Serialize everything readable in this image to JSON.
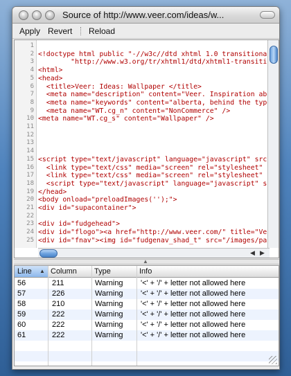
{
  "window": {
    "title": "Source of http://www.veer.com/ideas/w..."
  },
  "toolbar": {
    "apply": "Apply",
    "revert": "Revert",
    "reload": "Reload"
  },
  "editor": {
    "lines": [
      {
        "no": "1",
        "text": ""
      },
      {
        "no": "2",
        "text": "<!doctype html public \"-//w3c//dtd xhtml 1.0 transitiona"
      },
      {
        "no": "3",
        "text": "        \"http://www.w3.org/tr/xhtml1/dtd/xhtml1-transiti"
      },
      {
        "no": "4",
        "text": "<html>"
      },
      {
        "no": "5",
        "text": "<head>"
      },
      {
        "no": "6",
        "text": "  <title>Veer: Ideas: Wallpaper </title>"
      },
      {
        "no": "7",
        "text": "  <meta name=\"description\" content=\"Veer. Inspiration abo"
      },
      {
        "no": "8",
        "text": "  <meta name=\"keywords\" content=\"alberta, behind the type"
      },
      {
        "no": "9",
        "text": "  <meta name=\"WT.cg_n\" content=\"NonCommerce\" />"
      },
      {
        "no": "10",
        "text": "<meta name=\"WT.cg_s\" content=\"Wallpaper\" />"
      },
      {
        "no": "11",
        "text": ""
      },
      {
        "no": "12",
        "text": ""
      },
      {
        "no": "13",
        "text": ""
      },
      {
        "no": "14",
        "text": ""
      },
      {
        "no": "15",
        "text": "<script type=\"text/javascript\" language=\"javascript\" src"
      },
      {
        "no": "16",
        "text": "  <link type=\"text/css\" media=\"screen\" rel=\"stylesheet\" h"
      },
      {
        "no": "17",
        "text": "  <link type=\"text/css\" media=\"screen\" rel=\"stylesheet\" h"
      },
      {
        "no": "18",
        "text": "  <script type=\"text/javascript\" language=\"javascript\" sr"
      },
      {
        "no": "19",
        "text": "</head>"
      },
      {
        "no": "20",
        "text": "<body onload=\"preloadImages('');\">"
      },
      {
        "no": "21",
        "text": "<div id=\"supacontainer\">"
      },
      {
        "no": "22",
        "text": ""
      },
      {
        "no": "23",
        "text": "<div id=\"fudgehead\">"
      },
      {
        "no": "24",
        "text": "<div id=\"flogo\"><a href=\"http://www.veer.com/\" title=\"Ve"
      },
      {
        "no": "25",
        "text": "<div id=\"fnav\"><img id=\"fudgenav_shad_t\" src=\"/images/pa"
      }
    ]
  },
  "errors": {
    "headers": [
      "Line",
      "Column",
      "Type",
      "Info"
    ],
    "rows": [
      [
        "56",
        "211",
        "Warning",
        "'<' + '/' + letter not allowed here"
      ],
      [
        "57",
        "226",
        "Warning",
        "'<' + '/' + letter not allowed here"
      ],
      [
        "58",
        "210",
        "Warning",
        "'<' + '/' + letter not allowed here"
      ],
      [
        "59",
        "222",
        "Warning",
        "'<' + '/' + letter not allowed here"
      ],
      [
        "60",
        "222",
        "Warning",
        "'<' + '/' + letter not allowed here"
      ],
      [
        "61",
        "222",
        "Warning",
        "'<' + '/' + letter not allowed here"
      ]
    ]
  },
  "icons": {
    "close": "close-icon",
    "minimize": "minimize-icon",
    "zoom": "zoom-icon",
    "toolbar_toggle": "toolbar-toggle-icon",
    "sort": "sort-ascending-icon",
    "split": "split-handle-icon"
  }
}
